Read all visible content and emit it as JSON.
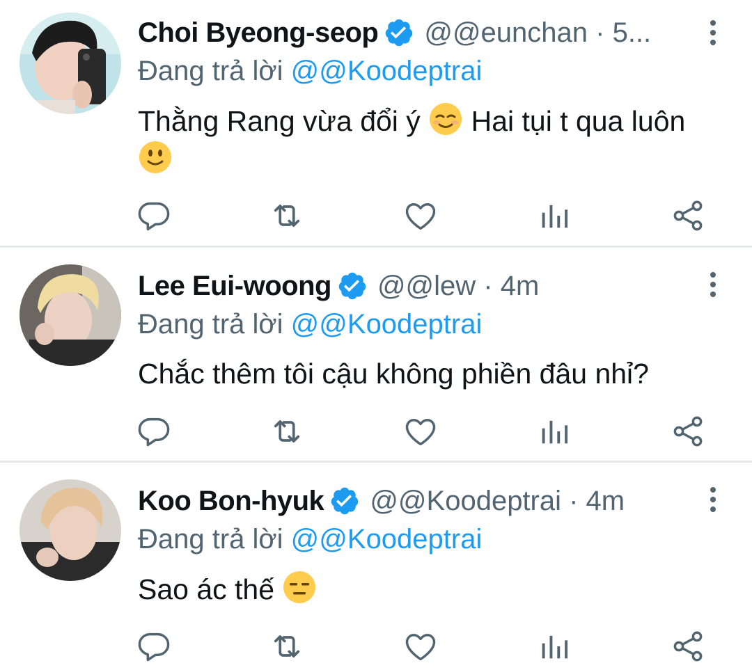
{
  "tweets": [
    {
      "name": "Choi Byeong-seop",
      "handle": "@@eunchan · 5...",
      "replying_prefix": "Đang trả lời",
      "replying_to": "@@Koodeptrai",
      "text_before": "Thằng Rang vừa đổi ý",
      "text_middle": "Hai tụi t qua luôn",
      "emoji1": "relieved-face-emoji",
      "emoji2": "slightly-smiling-face-emoji",
      "verified": true
    },
    {
      "name": "Lee Eui-woong",
      "handle": "@@lew · 4m",
      "replying_prefix": "Đang trả lời",
      "replying_to": "@@Koodeptrai",
      "text": "Chắc thêm tôi cậu không phiền đâu nhỉ?",
      "verified": true
    },
    {
      "name": "Koo Bon-hyuk",
      "handle": "@@Koodeptrai · 4m",
      "replying_prefix": "Đang trả lời",
      "replying_to": "@@Koodeptrai",
      "text": "Sao ác thế",
      "emoji": "expressionless-face-emoji",
      "verified": true
    }
  ],
  "icons": {
    "reply": "reply-icon",
    "retweet": "retweet-icon",
    "like": "heart-icon",
    "analytics": "analytics-icon",
    "share": "share-icon",
    "more": "more-vertical-icon",
    "verified": "verified-badge-icon"
  },
  "colors": {
    "accent": "#1d9bf0",
    "secondary_text": "#536471",
    "primary_text": "#0f1419",
    "divider": "#e6e8ea"
  }
}
